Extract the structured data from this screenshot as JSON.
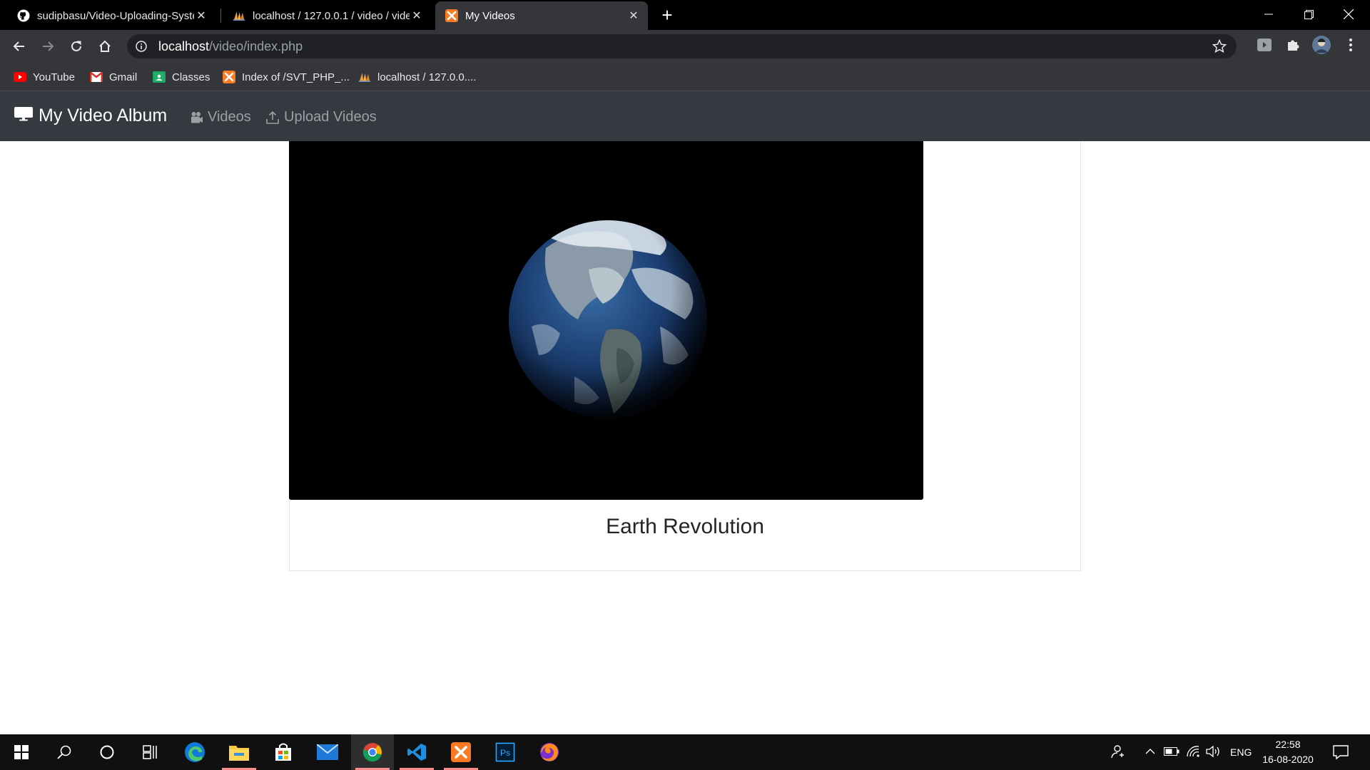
{
  "browser": {
    "tabs": [
      {
        "title": "sudipbasu/Video-Uploading-System",
        "icon": "github-icon",
        "active": false
      },
      {
        "title": "localhost / 127.0.0.1 / video / videos",
        "icon": "phpmyadmin-icon",
        "active": false
      },
      {
        "title": "My Videos",
        "icon": "xampp-icon",
        "active": true
      }
    ],
    "address": {
      "host": "localhost",
      "path": "/video/index.php"
    },
    "bookmarks": [
      {
        "label": "YouTube",
        "icon": "youtube-icon"
      },
      {
        "label": "Gmail",
        "icon": "gmail-icon"
      },
      {
        "label": "Classes",
        "icon": "classroom-icon"
      },
      {
        "label": "Index of /SVT_PHP_...",
        "icon": "xampp-icon"
      },
      {
        "label": "localhost / 127.0.0....",
        "icon": "phpmyadmin-icon"
      }
    ]
  },
  "navbar": {
    "brand": "My Video Album",
    "links": [
      {
        "label": "Videos",
        "icon": "video-camera-icon"
      },
      {
        "label": "Upload Videos",
        "icon": "upload-icon"
      }
    ]
  },
  "videos": [
    {
      "title": "Earth Revolution"
    }
  ],
  "taskbar": {
    "apps": [
      "start-icon",
      "search-icon",
      "cortana-icon",
      "task-view-icon",
      "edge-icon",
      "file-explorer-icon",
      "store-icon",
      "mail-icon",
      "chrome-icon",
      "vscode-icon",
      "xampp-icon",
      "photoshop-icon",
      "firefox-icon"
    ],
    "language": "ENG",
    "time": "22:58",
    "date": "16-08-2020"
  },
  "colors": {
    "navbar_bg": "#343a40",
    "nav_link": "#9ba0a5",
    "chrome_toolbar": "#35363a"
  }
}
